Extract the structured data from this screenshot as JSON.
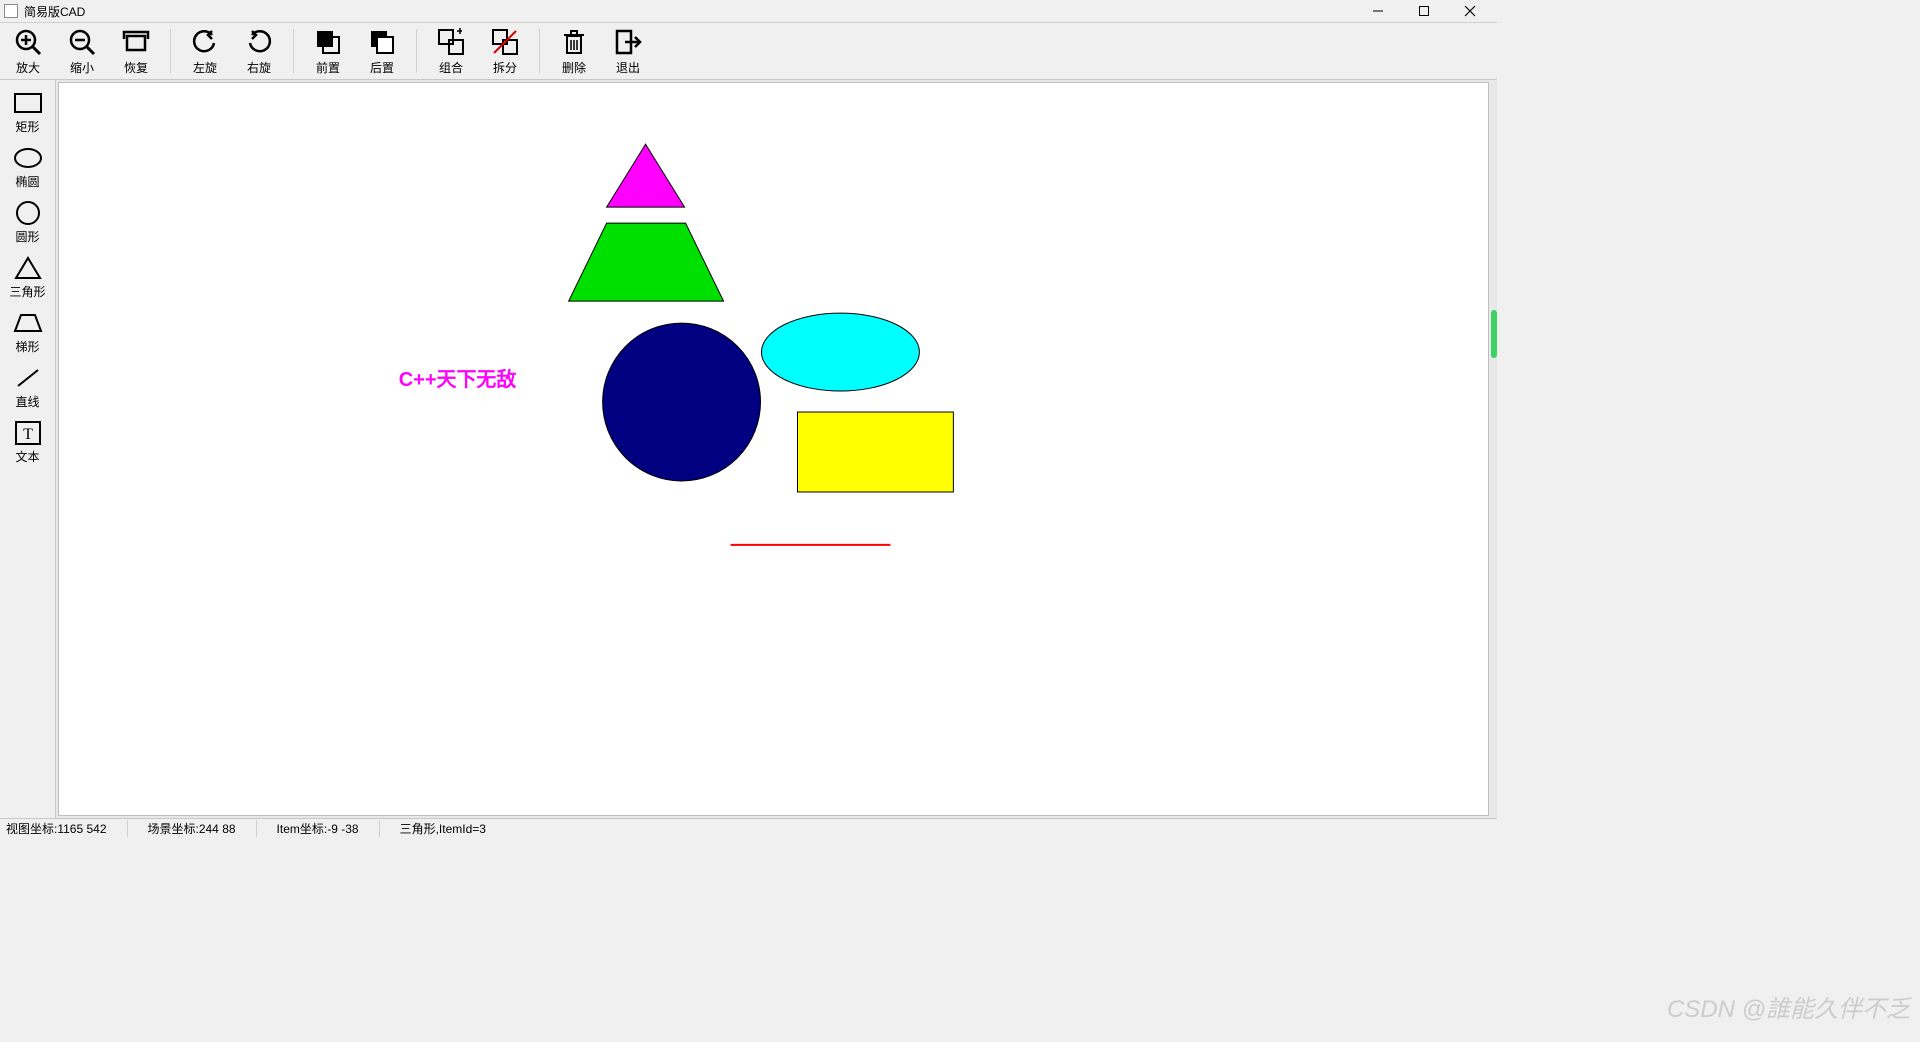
{
  "window": {
    "title": "简易版CAD"
  },
  "toolbar": [
    {
      "id": "zoom-in",
      "label": "放大"
    },
    {
      "id": "zoom-out",
      "label": "缩小"
    },
    {
      "id": "restore",
      "label": "恢复"
    },
    {
      "id": "rot-left",
      "label": "左旋"
    },
    {
      "id": "rot-right",
      "label": "右旋"
    },
    {
      "id": "front",
      "label": "前置"
    },
    {
      "id": "back",
      "label": "后置"
    },
    {
      "id": "group",
      "label": "组合"
    },
    {
      "id": "ungroup",
      "label": "拆分"
    },
    {
      "id": "delete",
      "label": "删除"
    },
    {
      "id": "exit",
      "label": "退出"
    }
  ],
  "shapes_panel": [
    {
      "id": "rect",
      "label": "矩形"
    },
    {
      "id": "ellipse",
      "label": "椭圆"
    },
    {
      "id": "circle",
      "label": "圆形"
    },
    {
      "id": "triangle",
      "label": "三角形"
    },
    {
      "id": "trapezoid",
      "label": "梯形"
    },
    {
      "id": "line",
      "label": "直线"
    },
    {
      "id": "text",
      "label": "文本"
    }
  ],
  "canvas": {
    "text_item": "C++天下无敌"
  },
  "status": {
    "view_coord": "视图坐标:1165 542",
    "scene_coord": "场景坐标:244 88",
    "item_coord": "Item坐标:-9 -38",
    "selection": "三角形,ItemId=3"
  },
  "watermark": "CSDN @誰能久伴不乏"
}
